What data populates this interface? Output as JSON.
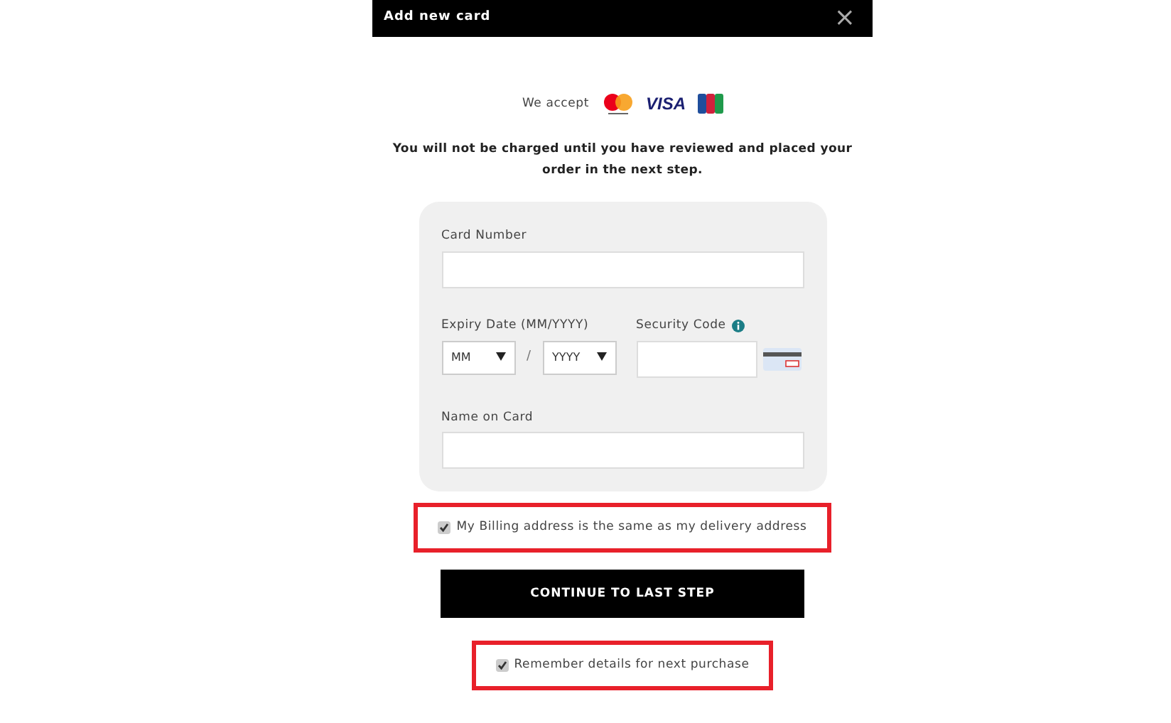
{
  "dialog": {
    "title": "Add new card",
    "close": "×"
  },
  "accept": {
    "label": "We accept",
    "cards": [
      {
        "kind": "mastercard"
      },
      {
        "kind": "visa",
        "label": "VISA"
      },
      {
        "kind": "jcb"
      }
    ]
  },
  "notice": "You will not be charged until you have reviewed and placed your order in the next step.",
  "form": {
    "card_number": {
      "label": "Card Number"
    },
    "expiry": {
      "label": "Expiry Date (MM/YYYY)",
      "month": "MM",
      "year": "YYYY",
      "separator": "/"
    },
    "security_code": {
      "label": "Security Code"
    },
    "name_on_card": {
      "label": "Name on Card"
    }
  },
  "billing_same": {
    "label": "My Billing address is the same as my delivery address",
    "checked": true,
    "highlighted": true
  },
  "continue_button": "CONTINUE TO LAST STEP",
  "remember": {
    "label": "Remember details for next purchase",
    "checked": true,
    "highlighted": true
  }
}
